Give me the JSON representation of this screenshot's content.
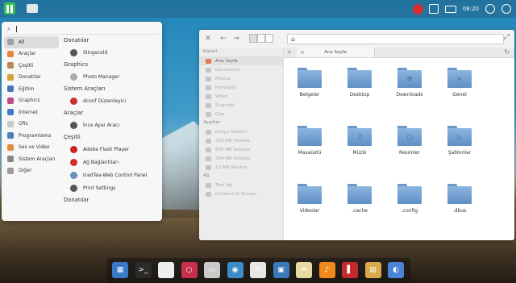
{
  "top_panel": {
    "clock": "08:20",
    "icons": [
      "manjaro-logo-icon",
      "folder-icon",
      "update-gear-icon",
      "network-icon",
      "battery-icon",
      "sound-icon",
      "power-icon"
    ]
  },
  "menu": {
    "search_value": "",
    "categories": [
      {
        "label": "All",
        "icon": "grid-icon",
        "color": "#9aa2a8",
        "active": true
      },
      {
        "label": "Araçlar",
        "icon": "tools-icon",
        "color": "#e3863a"
      },
      {
        "label": "Çeşitli",
        "icon": "misc-icon",
        "color": "#b58a56"
      },
      {
        "label": "Donatılar",
        "icon": "accessories-icon",
        "color": "#d6a03c"
      },
      {
        "label": "Eğitim",
        "icon": "education-icon",
        "color": "#4b72b6"
      },
      {
        "label": "Graphics",
        "icon": "graphics-icon",
        "color": "#c04a8a"
      },
      {
        "label": "İnternet",
        "icon": "internet-icon",
        "color": "#3d7cc9"
      },
      {
        "label": "Ofis",
        "icon": "office-icon",
        "color": "#c9c9c9"
      },
      {
        "label": "Programlama",
        "icon": "programming-icon",
        "color": "#4c7dbf"
      },
      {
        "label": "Ses ve Video",
        "icon": "multimedia-icon",
        "color": "#e08c3c"
      },
      {
        "label": "Sistem Araçları",
        "icon": "system-icon",
        "color": "#888888"
      },
      {
        "label": "Diğer",
        "icon": "other-icon",
        "color": "#9b9b9b"
      }
    ],
    "sections": [
      {
        "title": "Donatılar",
        "apps": [
          {
            "label": "Slingscold",
            "icon": "slingscold-icon",
            "color": "#555555"
          }
        ]
      },
      {
        "title": "Graphics",
        "apps": [
          {
            "label": "Photo Manager",
            "icon": "photo-manager-icon",
            "color": "#aaaaaa"
          }
        ]
      },
      {
        "title": "Sistem Araçları",
        "apps": [
          {
            "label": "dconf Düzenleyici",
            "icon": "dconf-icon",
            "color": "#cc2f2f"
          }
        ]
      },
      {
        "title": "Araçlar",
        "apps": [
          {
            "label": "İnce Ayar Aracı",
            "icon": "tweak-tool-icon",
            "color": "#555555"
          }
        ]
      },
      {
        "title": "Çeşitli",
        "apps": [
          {
            "label": "Adobe Flash Player",
            "icon": "flash-icon",
            "color": "#cc2222"
          },
          {
            "label": "Ağ Bağlantıları",
            "icon": "network-connections-icon",
            "color": "#cc2f2f"
          },
          {
            "label": "IcedTea-Web Control Panel",
            "icon": "icedtea-icon",
            "color": "#6b8fbf"
          },
          {
            "label": "Print Settings",
            "icon": "printer-icon",
            "color": "#555555"
          }
        ]
      },
      {
        "title": "Donatılar",
        "apps": []
      }
    ]
  },
  "file_manager": {
    "tab_label": "Ana Sayfa",
    "sidebar": {
      "personal_header": "Kişisel",
      "personal": [
        "Ana Sayfa",
        "Documenti",
        "Musica",
        "Immagini",
        "Video",
        "Scaricati",
        "Çöp"
      ],
      "devices_header": "Aygıtlar",
      "devices": [
        "Dosya Sistemi",
        "319 MB Volume",
        "805 MB Volume",
        "184 MB Volume",
        "13 MB Volume"
      ],
      "network_header": "Ağ",
      "network": [
        "Tüm Ağ",
        "Connect to Server..."
      ]
    },
    "items": [
      {
        "label": "Belgeler",
        "glyph": ""
      },
      {
        "label": "Desktop",
        "glyph": ""
      },
      {
        "label": "Downloads",
        "glyph": "⊕"
      },
      {
        "label": "Genel",
        "glyph": "<"
      },
      {
        "label": "Masaüstü",
        "glyph": ""
      },
      {
        "label": "Müzik",
        "glyph": "♫"
      },
      {
        "label": "Resimler",
        "glyph": "▢"
      },
      {
        "label": "Şablonlar",
        "glyph": "◺"
      },
      {
        "label": "Videolar",
        "glyph": ""
      },
      {
        "label": ".cache",
        "glyph": ""
      },
      {
        "label": ".config",
        "glyph": ""
      },
      {
        "label": ".dbus",
        "glyph": ""
      }
    ]
  },
  "dock": [
    {
      "name": "multitask-view-icon",
      "color": "#3a78c9",
      "glyph": "▦"
    },
    {
      "name": "terminal-icon",
      "color": "#2b2b2b",
      "glyph": ">_"
    },
    {
      "name": "calendar-icon",
      "color": "#eeeeee",
      "glyph": ""
    },
    {
      "name": "search-app-icon",
      "color": "#c7304a",
      "glyph": "○"
    },
    {
      "name": "files-icon",
      "color": "#c9c9c9",
      "glyph": "▭"
    },
    {
      "name": "browser-icon",
      "color": "#3b8cc9",
      "glyph": "◉"
    },
    {
      "name": "text-editor-icon",
      "color": "#e6e6e6",
      "glyph": "✎"
    },
    {
      "name": "photos-icon",
      "color": "#3b7ab8",
      "glyph": "▣"
    },
    {
      "name": "mail-icon",
      "color": "#e8d9a0",
      "glyph": "✉"
    },
    {
      "name": "music-icon",
      "color": "#f08a1c",
      "glyph": "♪"
    },
    {
      "name": "red-app-icon",
      "color": "#c42a2a",
      "glyph": "▌"
    },
    {
      "name": "packages-icon",
      "color": "#d9a84a",
      "glyph": "▤"
    },
    {
      "name": "settings-toggle-icon",
      "color": "#4a84d6",
      "glyph": "◐"
    }
  ]
}
